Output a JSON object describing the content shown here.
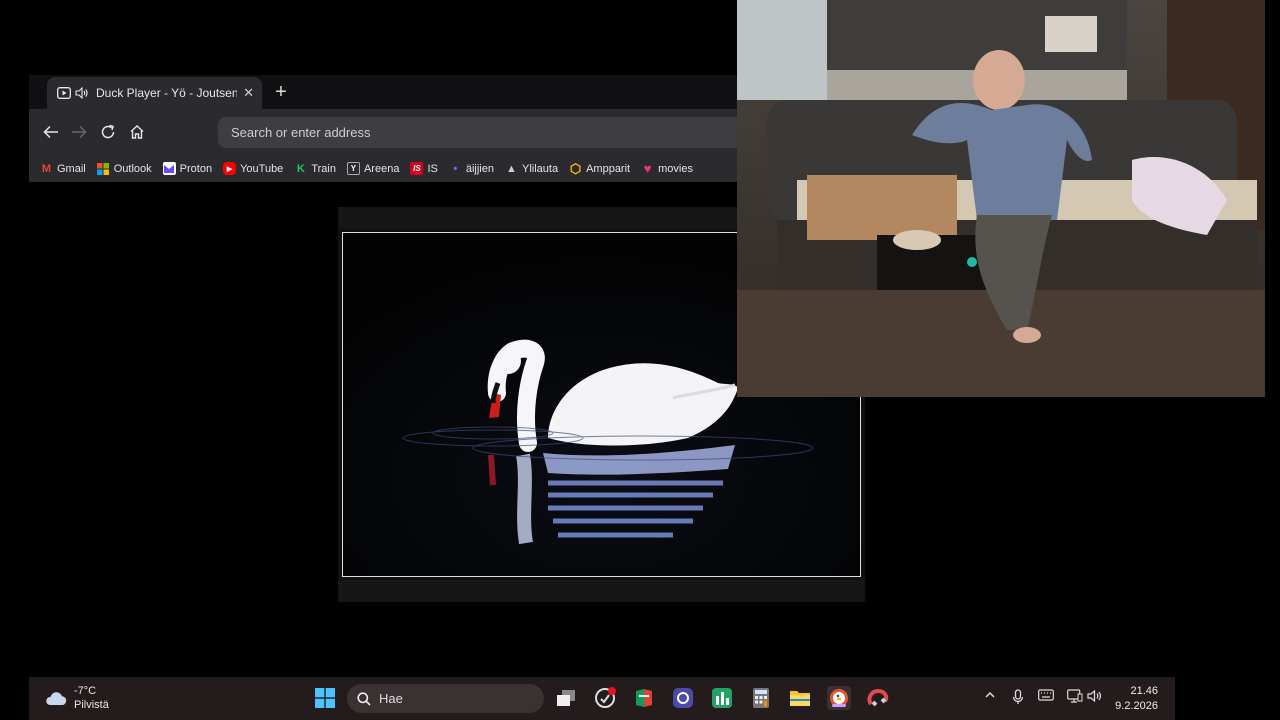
{
  "browser": {
    "tab": {
      "title": "Duck Player - Yö - Joutsen",
      "close_glyph": "✕",
      "icons": [
        "video-icon",
        "speaker-icon"
      ]
    },
    "new_tab_glyph": "+",
    "address_placeholder": "Search or enter address",
    "bookmarks": [
      {
        "label": "Gmail",
        "icon": "gmail-icon",
        "color": "#EA4335",
        "glyph": "M"
      },
      {
        "label": "Outlook",
        "icon": "microsoft-icon",
        "color": "#0078D4",
        "glyph": ""
      },
      {
        "label": "Proton",
        "icon": "proton-icon",
        "color": "#6D4AFF",
        "glyph": ""
      },
      {
        "label": "YouTube",
        "icon": "youtube-icon",
        "color": "#FF0000",
        "glyph": "▶"
      },
      {
        "label": "Train",
        "icon": "train-icon",
        "color": "#23C45E",
        "glyph": "K"
      },
      {
        "label": "Areena",
        "icon": "areena-icon",
        "color": "#ffffff",
        "glyph": "Y"
      },
      {
        "label": "IS",
        "icon": "is-icon",
        "color": "#D6001C",
        "glyph": "IS"
      },
      {
        "label": "äijjien",
        "icon": "aijjien-icon",
        "color": "#8a5cf6",
        "glyph": "•"
      },
      {
        "label": "Ylilauta",
        "icon": "ylilauta-icon",
        "color": "#cccccc",
        "glyph": "▲"
      },
      {
        "label": "Ampparit",
        "icon": "ampparit-icon",
        "color": "#FFC107",
        "glyph": "⬡"
      },
      {
        "label": "movies",
        "icon": "heart-icon",
        "color": "#E8396B",
        "glyph": "♥"
      }
    ]
  },
  "taskbar": {
    "weather": {
      "temp": "-7°C",
      "condition": "Pilvistä"
    },
    "search_label": "Hae",
    "clock": {
      "time": "21.46",
      "date": "9.2.2026"
    }
  },
  "colors": {
    "taskbar_bg": "#241c1c",
    "accent": "#cfa0ff"
  }
}
